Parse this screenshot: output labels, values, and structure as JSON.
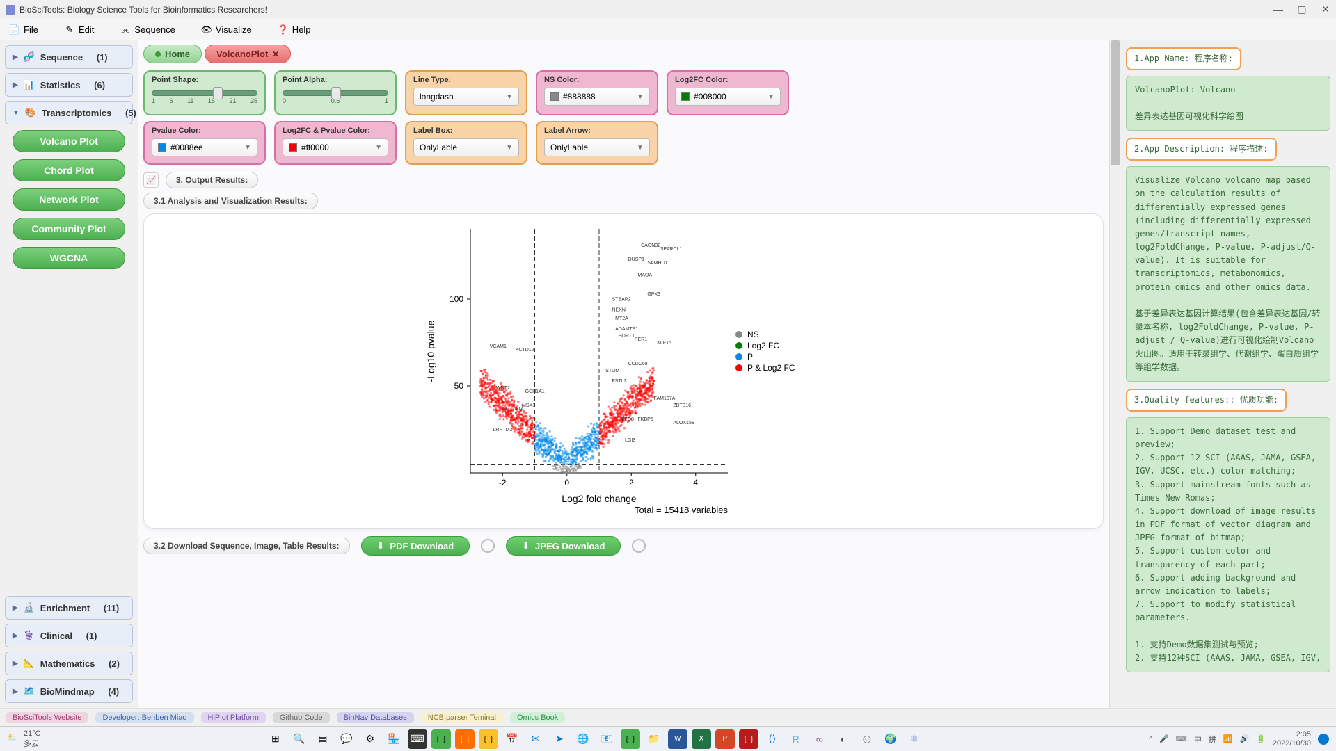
{
  "window": {
    "title": "BioSciTools: Biology Science Tools for Bioinformatics Researchers!"
  },
  "menu": {
    "file": "File",
    "edit": "Edit",
    "sequence": "Sequence",
    "visualize": "Visualize",
    "help": "Help"
  },
  "sidebar": {
    "panels_top": [
      {
        "label": "Sequence",
        "count": "(1)"
      },
      {
        "label": "Statistics",
        "count": "(6)"
      },
      {
        "label": "Transcriptomics",
        "count": "(5)"
      }
    ],
    "tools": [
      "Volcano Plot",
      "Chord Plot",
      "Network Plot",
      "Community Plot",
      "WGCNA"
    ],
    "panels_bottom": [
      {
        "label": "Enrichment",
        "count": "(11)"
      },
      {
        "label": "Clinical",
        "count": "(1)"
      },
      {
        "label": "Mathematics",
        "count": "(2)"
      },
      {
        "label": "BioMindmap",
        "count": "(4)"
      }
    ]
  },
  "tabs": {
    "home": "Home",
    "active": "VolcanoPlot"
  },
  "controls": {
    "point_shape": {
      "label": "Point Shape:",
      "ticks": [
        "1",
        "6",
        "11",
        "16",
        "21",
        "26"
      ],
      "pos": 60
    },
    "point_alpha": {
      "label": "Point Alpha:",
      "ticks": [
        "0",
        "0.5",
        "1"
      ],
      "pos": 50
    },
    "line_type": {
      "label": "Line Type:",
      "value": "longdash"
    },
    "ns_color": {
      "label": "NS Color:",
      "value": "#888888"
    },
    "log2fc_color": {
      "label": "Log2FC Color:",
      "value": "#008000"
    },
    "pvalue_color": {
      "label": "Pvalue Color:",
      "value": "#0088ee"
    },
    "both_color": {
      "label": "Log2FC & Pvalue Color:",
      "value": "#ff0000"
    },
    "label_box": {
      "label": "Label Box:",
      "value": "OnlyLable"
    },
    "label_arrow": {
      "label": "Label Arrow:",
      "value": "OnlyLable"
    }
  },
  "sections": {
    "output": "3. Output Results:",
    "analysis": "3.1 Analysis and Visualization Results:",
    "download": "3.2 Download Sequence, Image, Table Results:"
  },
  "downloads": {
    "pdf": "PDF Download",
    "jpeg": "JPEG Download"
  },
  "chart_data": {
    "type": "scatter",
    "title": "",
    "xlabel": "Log2 fold change",
    "ylabel": "-Log10 pvalue",
    "xlim": [
      -3,
      5
    ],
    "ylim": [
      0,
      140
    ],
    "xticks": [
      -2,
      0,
      2,
      4
    ],
    "yticks": [
      50,
      100
    ],
    "threshold_x": [
      -1,
      1
    ],
    "threshold_y": 5,
    "legend": [
      "NS",
      "Log2 FC",
      "P",
      "P & Log2 FC"
    ],
    "legend_colors": [
      "#888888",
      "#008000",
      "#0088ee",
      "#ff0000"
    ],
    "footer": "Total = 15418 variables",
    "top_labels": [
      "CAON32",
      "SPARCL1",
      "DUSP1",
      "SAMHD1",
      "MAOA",
      "GPX3",
      "STEAP2",
      "NEXN",
      "MT2A",
      "ADAMTS1",
      "SORT1",
      "PER1",
      "KLF15",
      "VCAM1",
      "KCTD12",
      "CCDC68",
      "STOM",
      "FSTL3",
      "WNT2",
      "GCH1A1",
      "FAM107A",
      "ZBTB16",
      "ALOX15B",
      "SLC7A14",
      "MSX1",
      "FZD8",
      "FKBP5",
      "LRRTM2",
      "LGI3"
    ]
  },
  "info": {
    "h1": "1.App Name:\n程序名称:",
    "b1": "VolcanoPlot: Volcano\n\n差异表达基因可视化科学绘图",
    "h2": "2.App Description:\n程序描述:",
    "b2": "Visualize Volcano volcano map based on the calculation results of differentially expressed genes (including differentially expressed genes/transcript names, log2FoldChange, P-value, P-adjust/Q-value). It is suitable for transcriptomics, metabonomics, protein omics and other omics data.\n\n基于差异表达基因计算结果(包含差异表达基因/转录本名称, log2FoldChange, P-value, P-adjust / Q-value)进行可视化绘制Volcano火山图。适用于转录组学、代谢组学、蛋白质组学等组学数据。",
    "h3": "3.Quality features::\n优质功能:",
    "b3": "1. Support Demo dataset test and preview;\n2. Support 12 SCI (AAAS, JAMA, GSEA, IGV, UCSC, etc.) color matching;\n3. Support mainstream fonts such as Times New Romas;\n4. Support download of image results in PDF format of vector diagram and JPEG format of bitmap;\n5. Support custom color and transparency of each part;\n6. Support adding background and arrow indication to labels;\n7. Support to modify statistical parameters.\n\n1. 支持Demo数据集测试与预览;\n2. 支持12种SCI (AAAS, JAMA, GSEA, IGV,"
  },
  "links": [
    "BioSciTools Website",
    "Developer: Benben Miao",
    "HiPlot Platform",
    "Github Code",
    "BinNav Databases",
    "NCBIparser Teminal",
    "Omics Book"
  ],
  "taskbar": {
    "weather_temp": "21°C",
    "weather_desc": "多云",
    "time": "2:05",
    "date": "2022/10/30"
  }
}
